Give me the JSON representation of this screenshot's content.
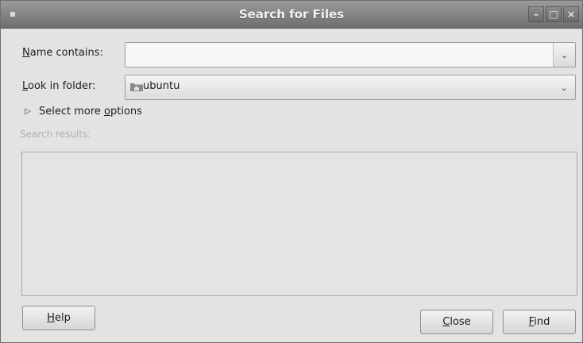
{
  "window": {
    "title": "Search for Files",
    "menu_icon": "window-menu-icon",
    "controls": [
      "minimize-icon",
      "maximize-icon",
      "close-icon"
    ]
  },
  "form": {
    "name_label_mnemonic": "N",
    "name_label_rest": "ame contains:",
    "name_value": "",
    "folder_label_mnemonic": "L",
    "folder_label_rest": "ook in folder:",
    "folder_value": "ubuntu",
    "folder_icon": "home-folder-icon"
  },
  "options": {
    "label_pre": "Select more ",
    "label_mnemonic": "o",
    "label_post": "ptions",
    "expanded": false
  },
  "results": {
    "label": "Search results:",
    "items": []
  },
  "buttons": {
    "help_mnemonic": "H",
    "help_rest": "elp",
    "close_mnemonic": "C",
    "close_rest": "lose",
    "find_mnemonic": "F",
    "find_rest": "ind"
  }
}
